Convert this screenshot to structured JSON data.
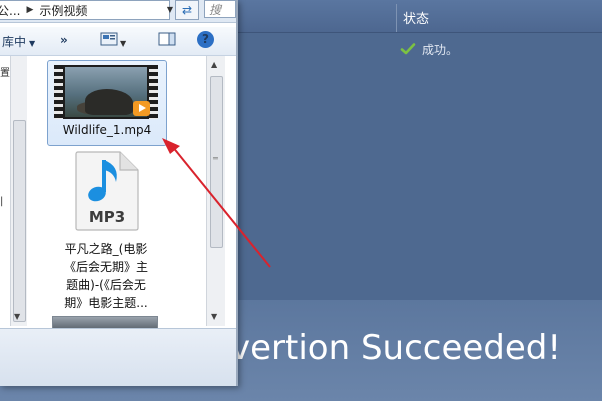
{
  "explorer": {
    "address_segments": [
      "公...",
      "示例视频"
    ],
    "search_placeholder": "搜",
    "toolbar": {
      "include_label": "库中",
      "more_label": "»",
      "view_icon": "view-icon",
      "pane_icon": "preview-pane-icon",
      "help_label": "?"
    },
    "left_pane_glyph": "置",
    "files": [
      {
        "name": "Wildlife_1.mp4",
        "type": "video"
      },
      {
        "name_lines": [
          "平凡之路_(电影",
          "《后会无期》主",
          "题曲)-(《后会无",
          "期》电影主题..."
        ],
        "type": "mp3",
        "icon_label": "MP3"
      }
    ]
  },
  "converter": {
    "status_header": "状态",
    "status_row": {
      "icon": "check-icon",
      "text": "成功。"
    },
    "message": "vertion Succeeded!"
  },
  "colors": {
    "converter_bg": "#4e6990",
    "arrow": "#d9232d",
    "check": "#7cc242",
    "mp3_note": "#1b8fe0"
  }
}
